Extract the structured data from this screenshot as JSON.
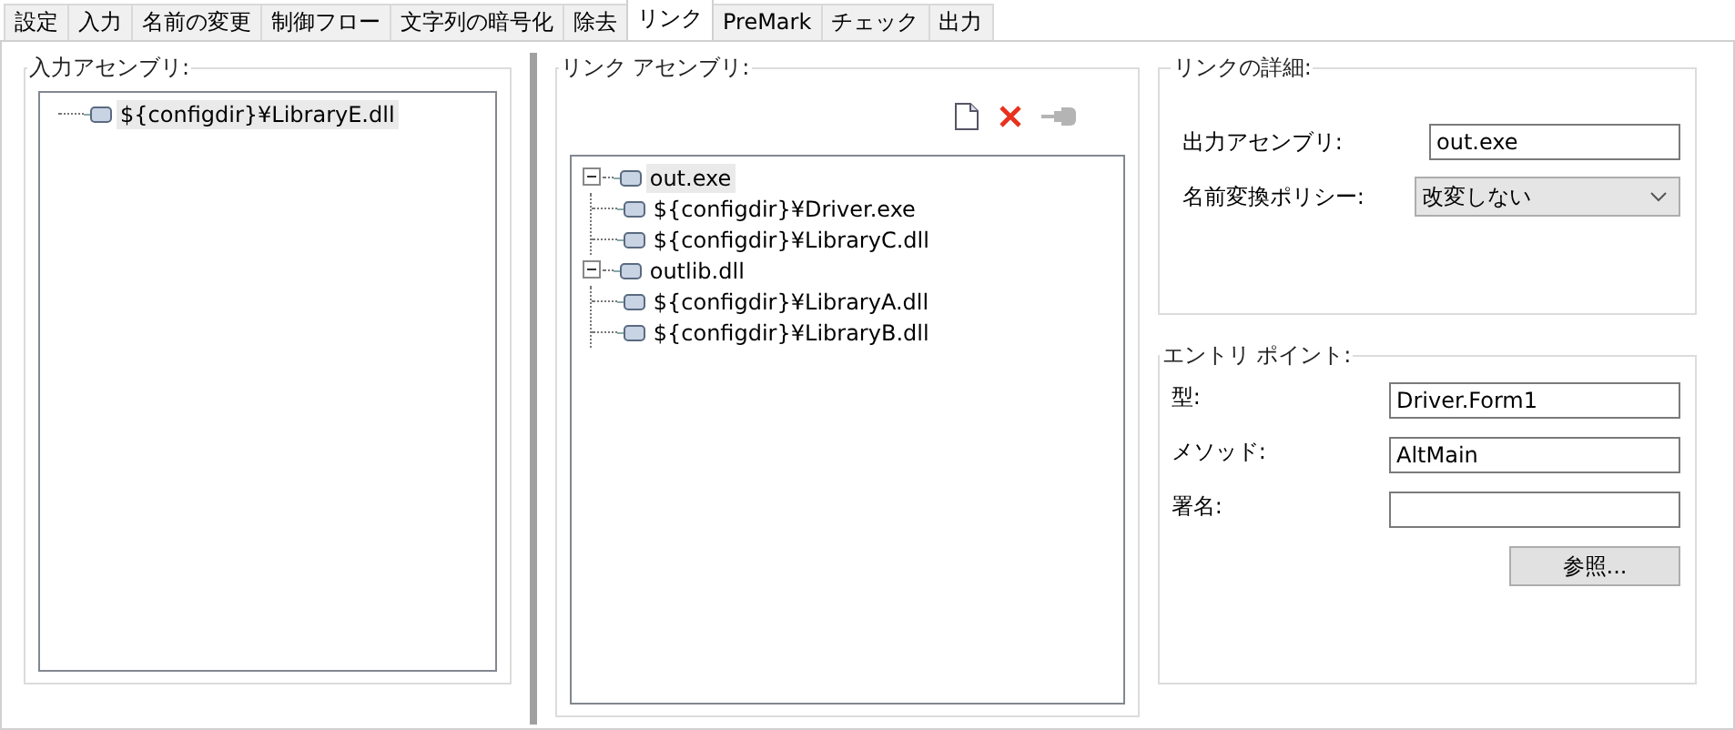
{
  "tabs": [
    {
      "label": "設定",
      "selected": false
    },
    {
      "label": "入力",
      "selected": false
    },
    {
      "label": "名前の変更",
      "selected": false
    },
    {
      "label": "制御フロー",
      "selected": false
    },
    {
      "label": "文字列の暗号化",
      "selected": false
    },
    {
      "label": "除去",
      "selected": false
    },
    {
      "label": "リンク",
      "selected": true
    },
    {
      "label": "PreMark",
      "selected": false
    },
    {
      "label": "チェック",
      "selected": false
    },
    {
      "label": "出力",
      "selected": false
    }
  ],
  "input_assemblies": {
    "title": "入力アセンブリ:",
    "items": [
      {
        "label": "${configdir}¥LibraryE.dll",
        "selected": true
      }
    ]
  },
  "link_assemblies": {
    "title": "リンク アセンブリ:",
    "toolbar": [
      {
        "kind": "new",
        "disabled": false
      },
      {
        "kind": "delete",
        "disabled": false
      },
      {
        "kind": "link",
        "disabled": true
      }
    ],
    "tree": [
      {
        "label": "out.exe",
        "selected": true,
        "expanded": true,
        "children": [
          {
            "label": "${configdir}¥Driver.exe",
            "selected": false
          },
          {
            "label": "${configdir}¥LibraryC.dll",
            "selected": false
          }
        ]
      },
      {
        "label": "outlib.dll",
        "selected": false,
        "expanded": true,
        "children": [
          {
            "label": "${configdir}¥LibraryA.dll",
            "selected": false
          },
          {
            "label": "${configdir}¥LibraryB.dll",
            "selected": false
          }
        ]
      }
    ]
  },
  "link_details": {
    "title": "リンクの詳細:",
    "output_assembly": {
      "label": "出力アセンブリ:",
      "value": "out.exe"
    },
    "rename_policy": {
      "label": "名前変換ポリシー:",
      "value": "改変しない"
    }
  },
  "entry_point": {
    "title": "エントリ ポイント:",
    "fields": [
      {
        "label": "型:",
        "value": "Driver.Form1"
      },
      {
        "label": "メソッド:",
        "value": "AltMain"
      },
      {
        "label": "署名:"
      }
    ],
    "browse_button": "参照..."
  }
}
